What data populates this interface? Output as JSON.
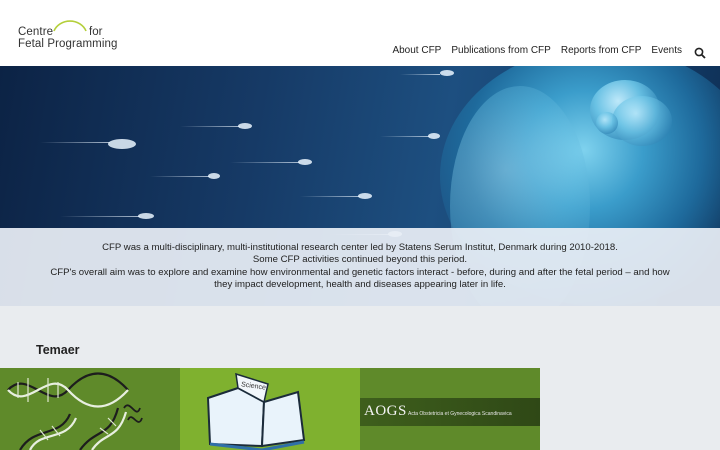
{
  "logo": {
    "line1": "Centre",
    "line1_for": "for",
    "line2": "Fetal Programming"
  },
  "nav": {
    "items": [
      {
        "label": "About CFP"
      },
      {
        "label": "Publications from CFP"
      },
      {
        "label": "Reports from CFP"
      },
      {
        "label": "Events"
      }
    ],
    "search_icon": "search-icon"
  },
  "hero": {
    "caption_lines": [
      "CFP was a multi-disciplinary, multi-institutional research center led by Statens Serum Institut, Denmark during 2010-2018.",
      "Some CFP activities continued beyond this period.",
      "CFP's overall aim was to explore and examine how environmental and genetic factors interact - before, during and after the fetal period – and how",
      "they impact development, health and diseases appearing later in life."
    ]
  },
  "section": {
    "title": "Temaer"
  },
  "tiles": [
    {
      "name": "dna-illustration"
    },
    {
      "name": "open-book-illustration",
      "book_label": "Science"
    },
    {
      "name": "aogs-journal",
      "title": "AOGS",
      "subtitle": "Acta Obstetricia et Gynecologica Scandinavica"
    }
  ],
  "colors": {
    "tile_dark_green": "#5f8a2a",
    "tile_light_green": "#7fb12f",
    "section_bg": "#e9ecef",
    "caption_bg": "#e8eef5"
  }
}
